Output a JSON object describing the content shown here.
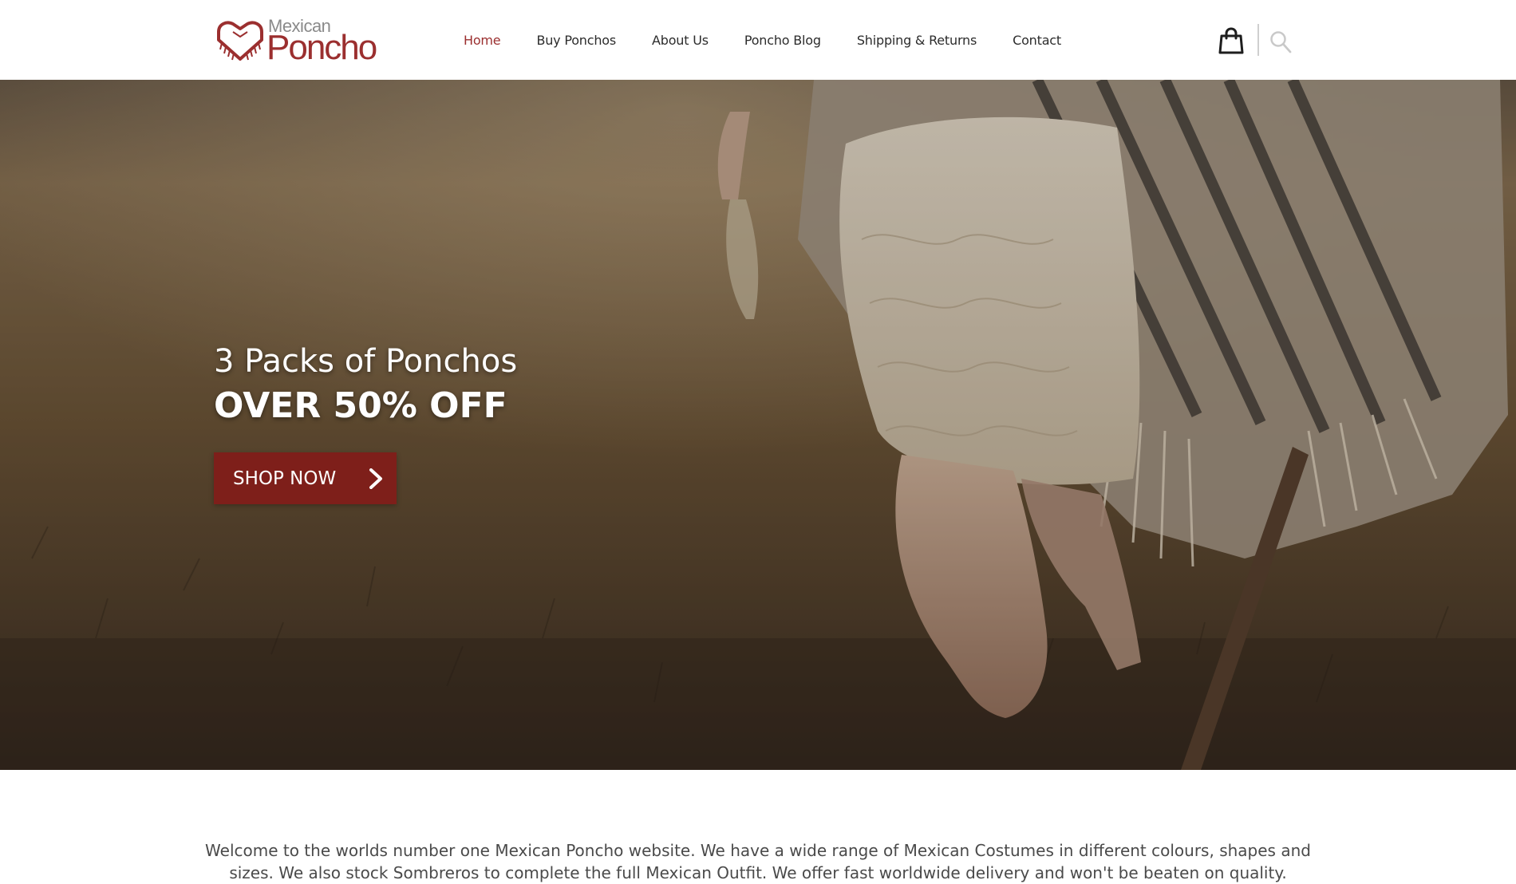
{
  "brand": {
    "top_word": "Mexican",
    "main_word": "Poncho",
    "accent_color": "#9b2f2f"
  },
  "nav": {
    "items": [
      {
        "label": "Home",
        "active": true
      },
      {
        "label": "Buy Ponchos",
        "active": false
      },
      {
        "label": "About Us",
        "active": false
      },
      {
        "label": "Poncho Blog",
        "active": false
      },
      {
        "label": "Shipping & Returns",
        "active": false
      },
      {
        "label": "Contact",
        "active": false
      }
    ],
    "icons": {
      "cart": "shopping-bag-icon",
      "search": "search-icon"
    }
  },
  "hero": {
    "subtitle": "3 Packs of Ponchos",
    "title": "OVER 50% OFF",
    "cta_label": "SHOP NOW",
    "cta_color": "#7e1f1a",
    "cta_icon": "chevron-right-icon"
  },
  "intro": {
    "text": "Welcome to the worlds number one Mexican Poncho website. We have a wide range of Mexican Costumes in different colours, shapes and sizes. We also stock Sombreros to complete the full Mexican Outfit. We offer fast worldwide delivery and won't be beaten on quality."
  }
}
